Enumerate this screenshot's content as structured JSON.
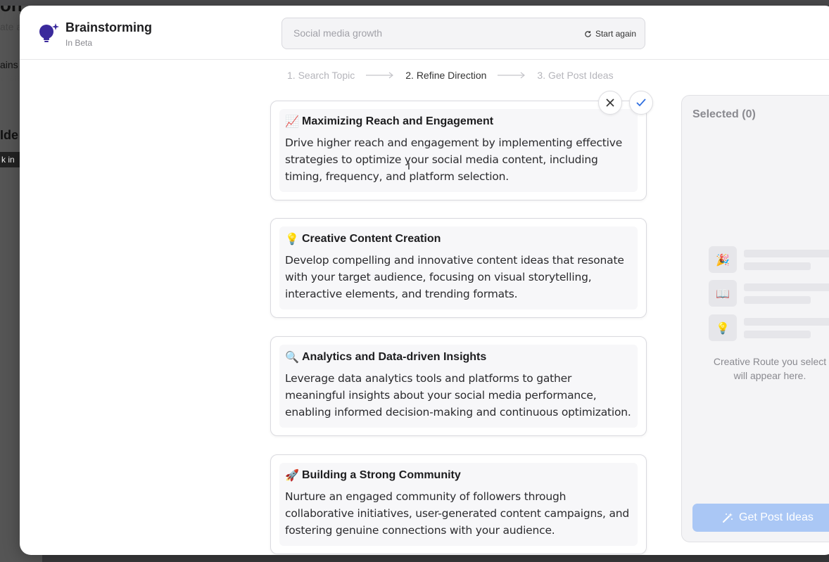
{
  "background_app": {
    "title": "ontent Lab",
    "subtitle": "ate a",
    "item_label": "ains",
    "item_sub": "enera",
    "section": "Ide",
    "chip": "k in"
  },
  "header": {
    "title": "Brainstorming",
    "badge": "In Beta",
    "topic_value": "Social media growth",
    "restart_label": "Start again"
  },
  "steps": [
    {
      "label": "1. Search Topic",
      "state": "done"
    },
    {
      "label": "2. Refine Direction",
      "state": "active"
    },
    {
      "label": "3. Get Post Ideas",
      "state": "pending"
    }
  ],
  "cards": [
    {
      "emoji": "📈",
      "title": "Maximizing Reach and Engagement",
      "description": "Drive higher reach and engagement by implementing effective strategies to optimize your social media content, including timing, frequency, and platform selection."
    },
    {
      "emoji": "💡",
      "title": "Creative Content Creation",
      "description": "Develop compelling and innovative content ideas that resonate with your target audience, focusing on visual storytelling, interactive elements, and trending formats."
    },
    {
      "emoji": "🔍",
      "title": "Analytics and Data-driven Insights",
      "description": "Leverage data analytics tools and platforms to gather meaningful insights about your social media performance, enabling informed decision-making and continuous optimization."
    },
    {
      "emoji": "🚀",
      "title": "Building a Strong Community",
      "description": "Nurture an engaged community of followers through collaborative initiatives, user-generated content campaigns, and fostering genuine connections with your audience."
    }
  ],
  "selected_panel": {
    "title": "Selected (0)",
    "placeholder_icons": [
      "🎉",
      "📖",
      "💡"
    ],
    "placeholder_text": "Creative Route you select will appear here.",
    "get_ideas_label": "Get Post Ideas"
  },
  "colors": {
    "accent": "#aac7f5",
    "brand_bulb": "#3b2a9c",
    "check": "#2f6fe0"
  }
}
